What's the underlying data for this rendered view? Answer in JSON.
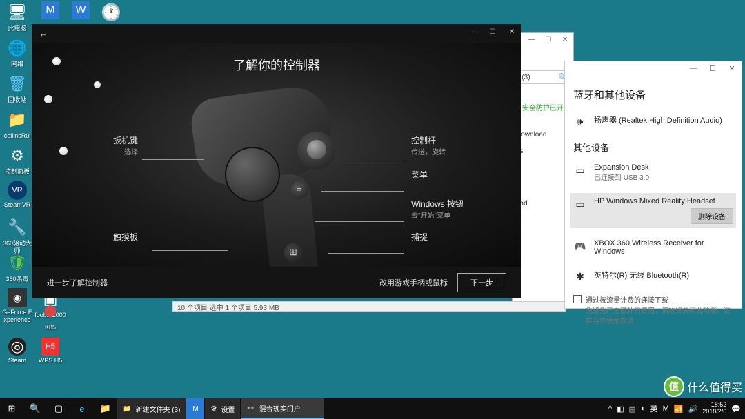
{
  "desktop": {
    "icons": [
      {
        "label": "此电脑",
        "glyph": "🖥"
      },
      {
        "label": "网络",
        "glyph": "🌐"
      },
      {
        "label": "回收站",
        "glyph": "🗑"
      },
      {
        "label": "collinsRui",
        "glyph": "📁"
      },
      {
        "label": "控制面板",
        "glyph": "⚙"
      },
      {
        "label": "SteamVR",
        "glyph": "VR"
      },
      {
        "label": "360驱动大师",
        "glyph": "🔧"
      },
      {
        "label": "360杀毒",
        "glyph": "🛡"
      },
      {
        "label": "foobar2000",
        "glyph": "▣"
      },
      {
        "label": "GeForce Experience",
        "glyph": "◉"
      },
      {
        "label": "Steam",
        "glyph": "◎"
      },
      {
        "label": "K85",
        "glyph": "⬢"
      },
      {
        "label": "WPS H5",
        "glyph": "H5"
      }
    ],
    "row2": [
      {
        "label": "",
        "glyph": "M"
      },
      {
        "label": "",
        "glyph": "W"
      },
      {
        "label": "",
        "glyph": "◔"
      }
    ]
  },
  "explorer": {
    "addr_count": "« (3)",
    "search_glyph": "🔍",
    "security": "● 安全防护已开启",
    "items": [
      "Download",
      "ds",
      "p",
      "oad"
    ],
    "status": "10 个项目    选中 1 个项目  5.93 MB"
  },
  "settings": {
    "title": "蓝牙和其他设备",
    "audio": {
      "name": "扬声器 (Realtek High Definition Audio)"
    },
    "section2": "其他设备",
    "devices": [
      {
        "name": "Expansion Desk",
        "sub": "已连接到 USB 3.0",
        "ico": "▭"
      },
      {
        "name": "HP Windows Mixed Reality Headset",
        "sub": "",
        "ico": "▭",
        "selected": true
      },
      {
        "name": "XBOX 360 Wireless Receiver for Windows",
        "sub": "",
        "ico": "🎮"
      },
      {
        "name": "英特尔(R) 无线 Bluetooth(R)",
        "sub": "",
        "ico": "✱"
      }
    ],
    "remove_btn": "删除设备",
    "note_title": "通过按流量计费的连接下载",
    "note_body": "免避免产生额外的费用，请始终关闭此功能。这样当你使用按流"
  },
  "mr": {
    "title": "了解你的控制器",
    "annotations": {
      "trigger": {
        "label": "扳机键",
        "sub": "选择"
      },
      "touchpad": {
        "label": "触摸板",
        "sub": ""
      },
      "stick": {
        "label": "控制杆",
        "sub": "传送，旋转"
      },
      "menu": {
        "label": "菜单",
        "sub": ""
      },
      "windows": {
        "label": "Windows 按钮",
        "sub": "去\"开始\"菜单"
      },
      "grab": {
        "label": "捕捉",
        "sub": ""
      }
    },
    "learn_more": "进一步了解控制器",
    "alt_input": "改用游戏手柄或鼠标",
    "next": "下一步"
  },
  "taskbar": {
    "tasks": [
      {
        "label": "新建文件夹 (3)",
        "ico": "📁"
      },
      {
        "label": "",
        "ico": "M"
      },
      {
        "label": "设置",
        "ico": "⚙"
      },
      {
        "label": "混合现实门户",
        "ico": "👓"
      }
    ],
    "tray": {
      "time": "18:52",
      "date": "2018/2/6"
    }
  },
  "watermark": {
    "badge": "值",
    "text": "什么值得买"
  }
}
